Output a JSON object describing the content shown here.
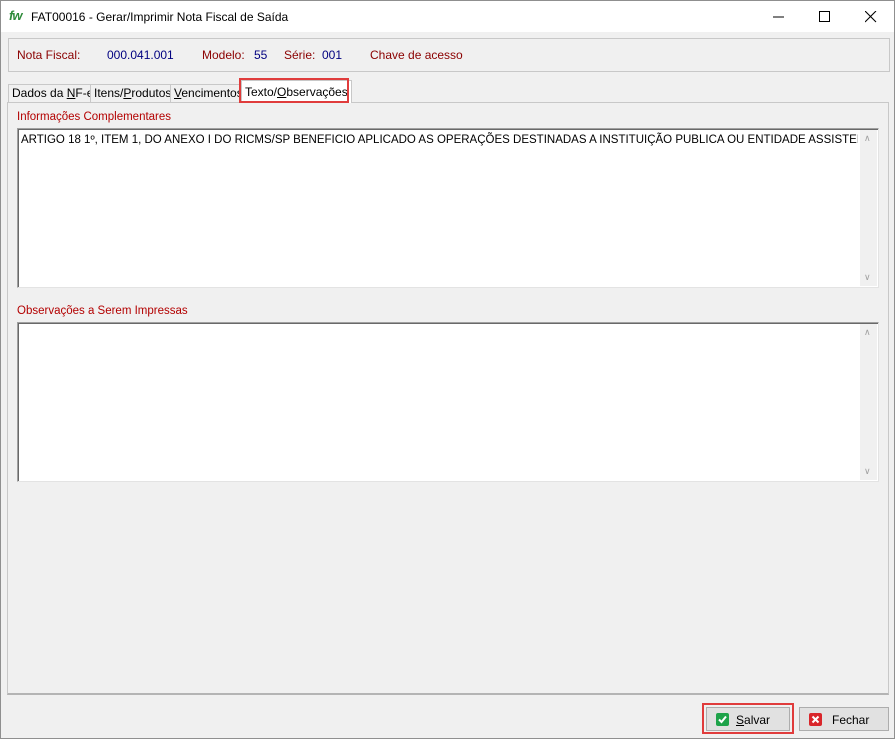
{
  "window": {
    "logo": "fw",
    "title": "FAT00016 - Gerar/Imprimir Nota Fiscal de Saída"
  },
  "header": {
    "nota_fiscal_label": "Nota Fiscal:",
    "nota_fiscal_value": "000.041.001",
    "modelo_label": "Modelo:",
    "modelo_value": "55",
    "serie_label": "Série:",
    "serie_value": "001",
    "chave_label": "Chave de acesso"
  },
  "tabs": [
    {
      "pre": "Dados da ",
      "u": "N",
      "post": "F-e"
    },
    {
      "pre": "Itens/",
      "u": "P",
      "post": "rodutos"
    },
    {
      "pre": "",
      "u": "V",
      "post": "encimentos"
    },
    {
      "pre": "Texto/",
      "u": "O",
      "post": "bservações"
    }
  ],
  "active_tab_index": 3,
  "fields": {
    "info_label": "Informações Complementares",
    "info_value": "ARTIGO 18 1º, ITEM 1, DO ANEXO I DO RICMS/SP BENEFICIO APLICADO AS OPERAÇÕES DESTINADAS A INSTITUIÇÃO PUBLICA OU ENTIDADE ASSISTENCIAL",
    "obs_label": "Observações a Serem Impressas",
    "obs_value": ""
  },
  "buttons": {
    "save": {
      "pre": "",
      "u": "S",
      "post": "alvar"
    },
    "close": {
      "label": "Fechar"
    }
  },
  "colors": {
    "label_red": "#8b0000",
    "value_blue": "#000080",
    "highlight": "#e03c3c",
    "save_icon": "#1fa34a",
    "close_icon": "#d9262b"
  }
}
